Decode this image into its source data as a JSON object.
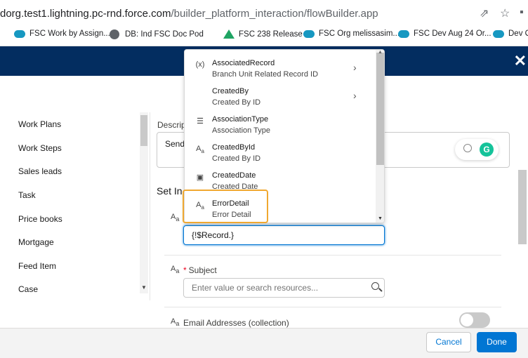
{
  "browser": {
    "url_main": "dorg.test1.lightning.pc-rnd.force.com",
    "url_rest": "/builder_platform_interaction/flowBuilder.app",
    "bookmarks": [
      "FSC Work by Assign...",
      "DB: Ind FSC Doc Pod",
      "FSC 238 Release",
      "FSC Org melissasim...",
      "FSC Dev Aug 24 Or...",
      "Dev O"
    ]
  },
  "sidebar": {
    "items": [
      "Work Plans",
      "Work Steps",
      "Sales leads",
      "Task",
      "Price books",
      "Mortgage",
      "Feed Item",
      "Case"
    ]
  },
  "main": {
    "description_label": "Descript",
    "description_value": "Send",
    "set_label": "Set In",
    "record_value": "{!$Record.}",
    "subject_label": "Subject",
    "subject_placeholder": "Enter value or search resources...",
    "email_label": "Email Addresses (collection)"
  },
  "dropdown": {
    "items": [
      {
        "name": "AssociatedRecord",
        "sub": "Branch Unit Related Record ID",
        "icon": "variable-icon"
      },
      {
        "name": "CreatedBy",
        "sub": "Created By ID",
        "icon": "none"
      },
      {
        "name": "AssociationType",
        "sub": "Association Type",
        "icon": "picklist-icon"
      },
      {
        "name": "CreatedById",
        "sub": "Created By ID",
        "icon": "text-icon"
      },
      {
        "name": "CreatedDate",
        "sub": "Created Date",
        "icon": "date-icon"
      },
      {
        "name": "ErrorDetail",
        "sub": "Error Detail",
        "icon": "text-icon"
      }
    ]
  },
  "footer": {
    "cancel": "Cancel",
    "done": "Done"
  },
  "colors": {
    "header": "#032d60",
    "brand_blue": "#0176d3",
    "highlight": "#f0a830"
  }
}
